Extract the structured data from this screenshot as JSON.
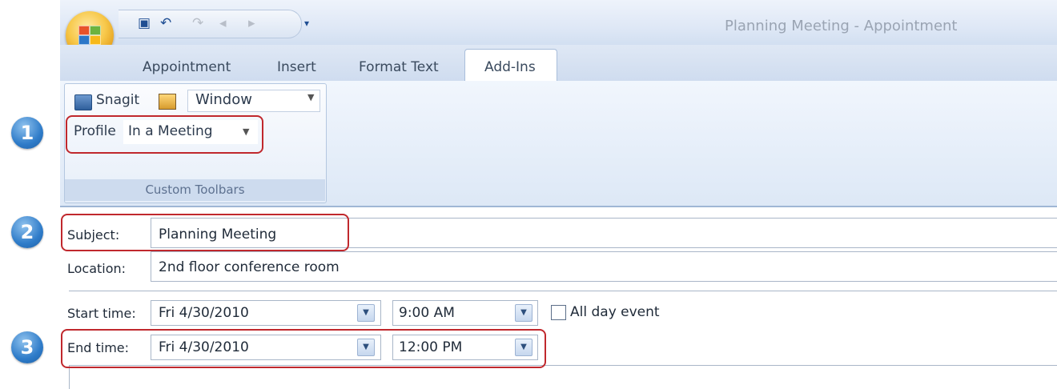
{
  "window": {
    "title": "Planning Meeting - Appointment"
  },
  "quick_access": {
    "items": [
      {
        "icon": "save-icon",
        "glyph": "▣"
      },
      {
        "icon": "undo-icon",
        "glyph": "↶"
      },
      {
        "icon": "redo-icon",
        "glyph": "↷"
      },
      {
        "icon": "previous-item-icon",
        "glyph": "◂"
      },
      {
        "icon": "next-item-icon",
        "glyph": "▸"
      },
      {
        "icon": "customize-qat-icon",
        "glyph": "▾"
      }
    ]
  },
  "tabs": [
    {
      "label": "Appointment",
      "selected": false
    },
    {
      "label": "Insert",
      "selected": false
    },
    {
      "label": "Format Text",
      "selected": false
    },
    {
      "label": "Add-Ins",
      "selected": true
    }
  ],
  "ribbon": {
    "group_caption": "Custom Toolbars",
    "snagit_label": "Snagit",
    "capture_mode": "Window",
    "profile_label": "Profile",
    "profile_value": "In a Meeting"
  },
  "callouts": [
    "1",
    "2",
    "3"
  ],
  "form": {
    "subject_label": "Subject:",
    "subject_value": "Planning Meeting",
    "location_label": "Location:",
    "location_value": "2nd floor conference room",
    "start_label": "Start time:",
    "start_date": "Fri 4/30/2010",
    "start_time": "9:00 AM",
    "all_day_label": "All day event",
    "all_day_checked": false,
    "end_label": "End time:",
    "end_date": "Fri 4/30/2010",
    "end_time": "12:00 PM"
  },
  "colors": {
    "callout": "#c0282d",
    "badge": "#2f7cc9",
    "ribbon": "#dde8f6"
  }
}
